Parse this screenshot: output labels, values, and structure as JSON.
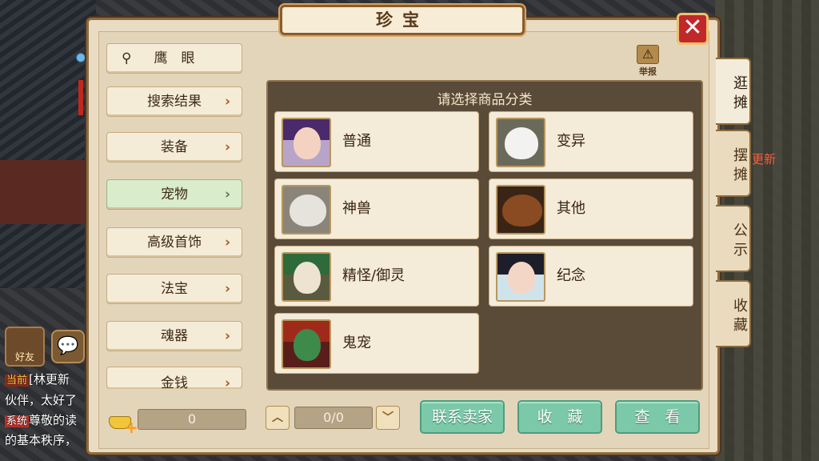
{
  "window": {
    "title": "珍宝",
    "close_symbol": "✕"
  },
  "sidebar": {
    "search_label": "鹰　眼",
    "items": [
      {
        "label": "搜索结果"
      },
      {
        "label": "装备"
      },
      {
        "label": "宠物",
        "active": true
      },
      {
        "label": "高级首饰"
      },
      {
        "label": "法宝"
      },
      {
        "label": "魂器"
      },
      {
        "label": "金钱"
      }
    ],
    "chevron": "›"
  },
  "report": {
    "icon": "⚠",
    "label": "举报"
  },
  "content": {
    "title": "请选择商品分类",
    "categories": [
      {
        "label": "普通",
        "icon": "girl-portrait-icon"
      },
      {
        "label": "变异",
        "icon": "white-dog-icon"
      },
      {
        "label": "神兽",
        "icon": "white-tiger-icon"
      },
      {
        "label": "其他",
        "icon": "bear-icon"
      },
      {
        "label": "精怪/御灵",
        "icon": "panda-mask-icon"
      },
      {
        "label": "纪念",
        "icon": "boy-portrait-icon"
      },
      {
        "label": "鬼宠",
        "icon": "green-demon-icon"
      }
    ]
  },
  "tabs": [
    {
      "label": "逛摊",
      "active": true
    },
    {
      "label": "摆摊"
    },
    {
      "label": "公示"
    },
    {
      "label": "收藏"
    }
  ],
  "bottom": {
    "money_value": "0",
    "page_display": "0/0",
    "up_symbol": "︿",
    "down_symbol": "﹀",
    "contact_seller": "联系卖家",
    "favorite": "收　藏",
    "view": "查　看"
  },
  "background": {
    "friend_label": "好友",
    "chat_icon": "💬",
    "news_text": "更新",
    "chat_lines": [
      {
        "tag": "当前",
        "text": "[林更新"
      },
      {
        "tag": "",
        "text": "伙伴，太好了"
      },
      {
        "tag": "系统",
        "text": "尊敬的读"
      },
      {
        "tag": "",
        "text": "的基本秩序，"
      }
    ]
  },
  "colors": {
    "accent_green": "#7bc9a9",
    "panel_bg": "#e9dcc2",
    "close_red": "#c0282a"
  }
}
